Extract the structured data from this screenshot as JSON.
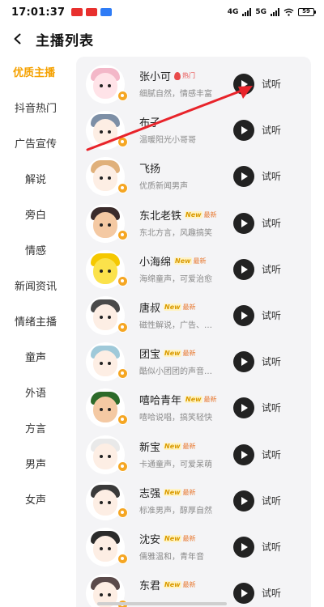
{
  "status_bar": {
    "time": "17:01:37",
    "net1": "4G",
    "net2": "5G",
    "battery": "59"
  },
  "header": {
    "title": "主播列表"
  },
  "sidebar": {
    "active_color": "#f5a100",
    "items": [
      {
        "label": "优质主播",
        "active": true
      },
      {
        "label": "抖音热门"
      },
      {
        "label": "广告宣传"
      },
      {
        "label": "解说"
      },
      {
        "label": "旁白"
      },
      {
        "label": "情感"
      },
      {
        "label": "新闻资讯"
      },
      {
        "label": "情绪主播"
      },
      {
        "label": "童声"
      },
      {
        "label": "外语"
      },
      {
        "label": "方言"
      },
      {
        "label": "男声"
      },
      {
        "label": "女声"
      }
    ]
  },
  "list": {
    "items": [
      {
        "name": "张小可",
        "badge": "hot",
        "badge_text": "热门",
        "desc": "细腻自然，情感丰富",
        "action": "试听",
        "avatar_skin": "#ffe3e8",
        "avatar_hair": "#f3b7c8"
      },
      {
        "name": "布子",
        "badge": "",
        "badge_text": "",
        "desc": "温暖阳光小哥哥",
        "action": "试听",
        "avatar_skin": "#fdeee4",
        "avatar_hair": "#7d8fa6"
      },
      {
        "name": "飞扬",
        "badge": "",
        "badge_text": "",
        "desc": "优质新闻男声",
        "action": "试听",
        "avatar_skin": "#fdeee4",
        "avatar_hair": "#e0b07a"
      },
      {
        "name": "东北老铁",
        "badge": "new",
        "badge_text": "最新",
        "desc": "东北方言，风趣搞笑",
        "action": "试听",
        "avatar_skin": "#f4c9a3",
        "avatar_hair": "#3a2b2b"
      },
      {
        "name": "小海绵",
        "badge": "new",
        "badge_text": "最新",
        "desc": "海绵童声，可爱治愈",
        "action": "试听",
        "avatar_skin": "#fbe24b",
        "avatar_hair": "#f5c800"
      },
      {
        "name": "唐叔",
        "badge": "new",
        "badge_text": "最新",
        "desc": "磁性解说，广告、…",
        "action": "试听",
        "avatar_skin": "#fdeee4",
        "avatar_hair": "#4a4a4a"
      },
      {
        "name": "团宝",
        "badge": "new",
        "badge_text": "最新",
        "desc": "酷似小团团的声音…",
        "action": "试听",
        "avatar_skin": "#fdeee4",
        "avatar_hair": "#9fc9d9"
      },
      {
        "name": "嘻哈青年",
        "badge": "new",
        "badge_text": "最新",
        "desc": "嘻哈说唱，搞笑轻快",
        "action": "试听",
        "avatar_skin": "#f4c9a3",
        "avatar_hair": "#2d6b2a"
      },
      {
        "name": "新宝",
        "badge": "new",
        "badge_text": "最新",
        "desc": "卡通童声，可爱呆萌",
        "action": "试听",
        "avatar_skin": "#fdeee4",
        "avatar_hair": "#e9e9e9"
      },
      {
        "name": "志强",
        "badge": "new",
        "badge_text": "最新",
        "desc": "标准男声，醇厚自然",
        "action": "试听",
        "avatar_skin": "#fdeee4",
        "avatar_hair": "#3a3a3a"
      },
      {
        "name": "沈安",
        "badge": "new",
        "badge_text": "最新",
        "desc": "儒雅温和，青年音",
        "action": "试听",
        "avatar_skin": "#fdeee4",
        "avatar_hair": "#2b2b2b"
      },
      {
        "name": "东君",
        "badge": "new",
        "badge_text": "最新",
        "desc": "",
        "action": "试听",
        "avatar_skin": "#fdeee4",
        "avatar_hair": "#5a4a4a"
      }
    ]
  },
  "annotation": {
    "arrow_color": "#e8232a"
  }
}
